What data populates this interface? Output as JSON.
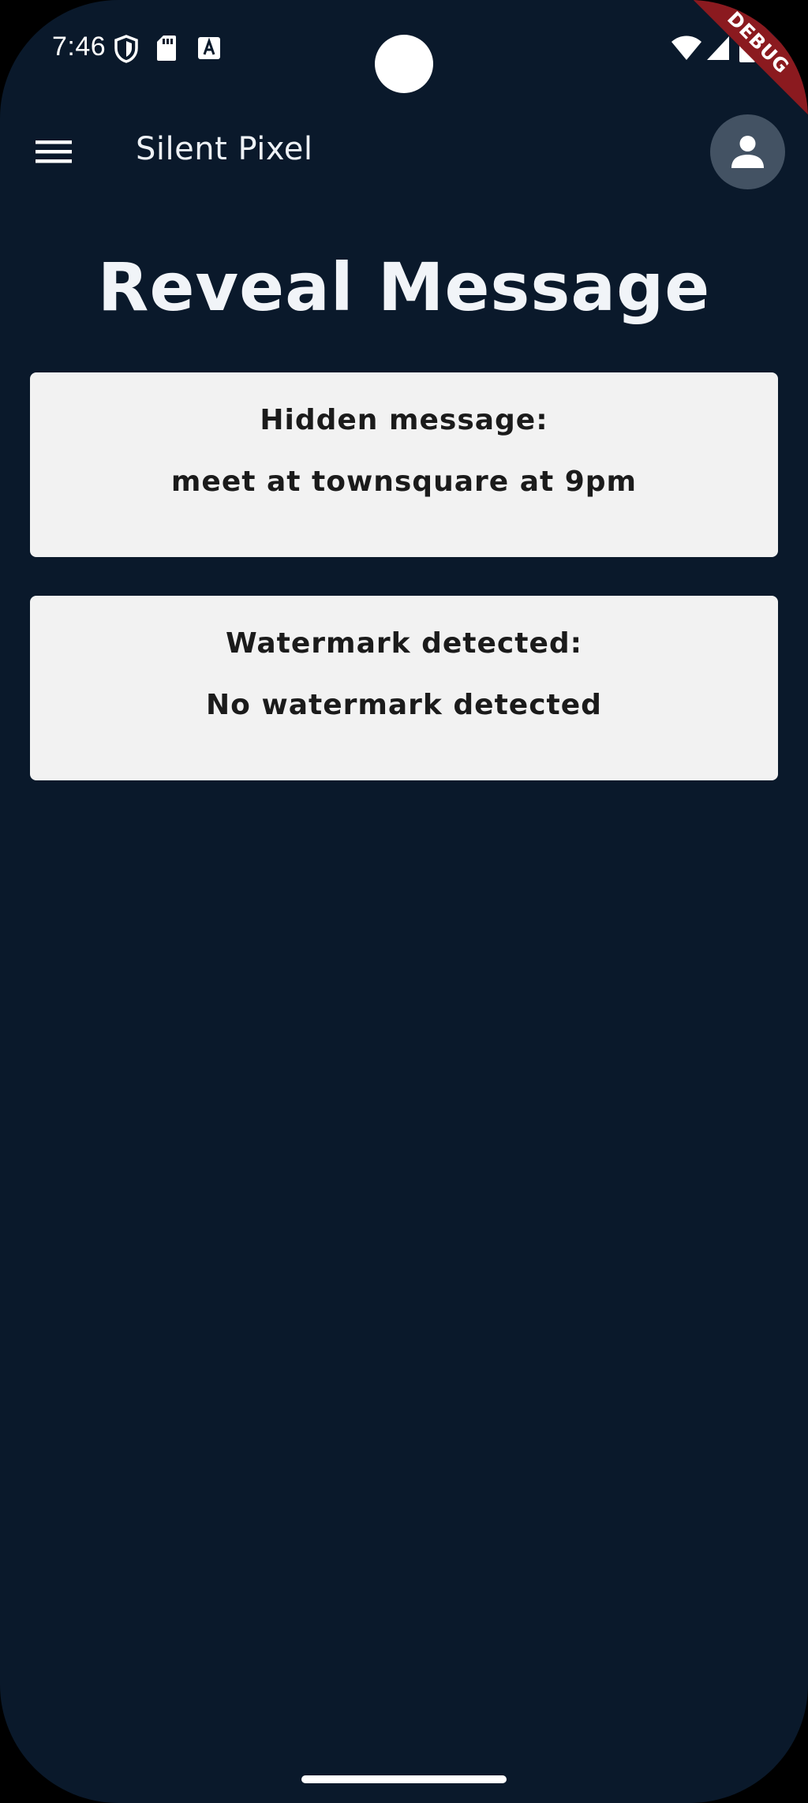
{
  "status_bar": {
    "time": "7:46",
    "left_icons": [
      "shield-icon",
      "sd-card-icon",
      "font-a-icon"
    ],
    "right_icons": [
      "wifi-icon",
      "cell-signal-icon",
      "battery-icon"
    ]
  },
  "debug_banner": "DEBUG",
  "app_bar": {
    "title": "Silent Pixel",
    "menu_icon": "menu-icon",
    "profile_icon": "person-icon"
  },
  "page": {
    "title": "Reveal Message"
  },
  "cards": {
    "hidden": {
      "label": "Hidden message:",
      "value": "meet at townsquare at 9pm"
    },
    "watermark": {
      "label": "Watermark detected:",
      "value": "No watermark detected"
    }
  },
  "colors": {
    "background": "#0a192b",
    "card": "#f2f2f2",
    "avatar": "#435263",
    "debug_ribbon": "#8b1a1f",
    "text_light": "#f1f4f8",
    "text_dark": "#1b1b1b"
  }
}
